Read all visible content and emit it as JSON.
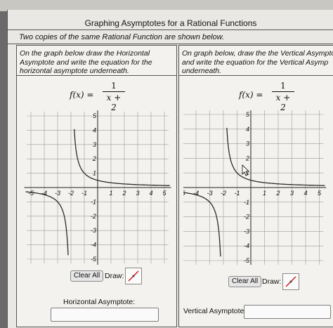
{
  "title": "Graphing Asymptotes for a Rational Functions",
  "intro": "Two copies of the same Rational Function are shown below.",
  "left": {
    "instructions": [
      "On the graph below draw the Horizontal",
      "Asymptote and write the equation for the",
      "horizontal asymptote underneath."
    ],
    "function_lhs": "f(x) =",
    "numerator": "1",
    "denominator": "x + 2",
    "clear_label": "Clear All",
    "draw_label": "Draw:",
    "answer_label": "Horizontal Asymptote:",
    "answer_value": ""
  },
  "right": {
    "instructions": [
      "On graph below, draw the the Vertical Asympto",
      "and write the equation for the Vertical Asymp",
      "underneath."
    ],
    "function_lhs": "f(x) =",
    "numerator": "1",
    "denominator": "x + 2",
    "clear_label": "Clear All",
    "draw_label": "Draw:",
    "answer_label": "Vertical Asymptote:",
    "answer_value": ""
  },
  "graph": {
    "x_ticks": [
      "-5",
      "-4",
      "-3",
      "-2",
      "-1",
      "1",
      "2",
      "3",
      "4",
      "5"
    ],
    "y_ticks": [
      "5",
      "4",
      "3",
      "2",
      "1",
      "-1",
      "-2",
      "-3",
      "-4",
      "-5"
    ],
    "xlim": [
      -5,
      5
    ],
    "ylim": [
      -5,
      5
    ],
    "curve": "1/(x+2)",
    "curve_color": "#2a2a2a",
    "grid_color": "#9a9a9a",
    "tool_color": "#d11a1a"
  }
}
